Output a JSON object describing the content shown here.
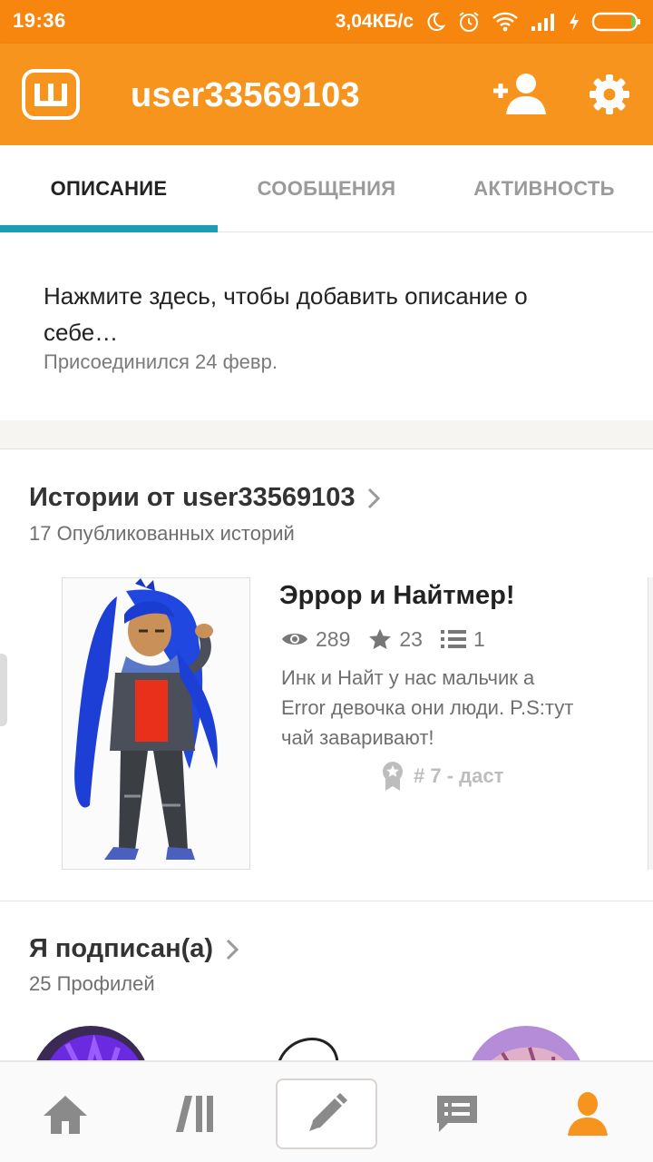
{
  "status_bar": {
    "time": "19:36",
    "speed": "3,04КБ/с"
  },
  "app_bar": {
    "title": "user33569103",
    "logo_letter": "ш",
    "brand_color": "#f7941d"
  },
  "tabs": [
    {
      "label": "ОПИСАНИЕ",
      "active": true
    },
    {
      "label": "СООБЩЕНИЯ",
      "active": false
    },
    {
      "label": "АКТИВНОСТЬ",
      "active": false
    }
  ],
  "profile": {
    "description_prompt": "Нажмите здесь, чтобы добавить описание о себе…",
    "joined": "Присоединился 24 февр."
  },
  "stories": {
    "title": "Истории от user33569103",
    "subtitle": "17 Опубликованных историй",
    "items": [
      {
        "title": "Эррор и Найтмер!",
        "views": "289",
        "votes": "23",
        "parts": "1",
        "description": "Инк и Найт у нас мальчик а Error девочка они люди. P.S:тут чай заваривают!",
        "rank": "# 7 - даст"
      }
    ]
  },
  "following": {
    "title": "Я подписан(а)",
    "subtitle": "25 Профилей"
  },
  "bottom_nav": [
    {
      "name": "home-icon"
    },
    {
      "name": "library-icon"
    },
    {
      "name": "write-icon"
    },
    {
      "name": "messages-icon"
    },
    {
      "name": "profile-icon",
      "active": true
    }
  ]
}
